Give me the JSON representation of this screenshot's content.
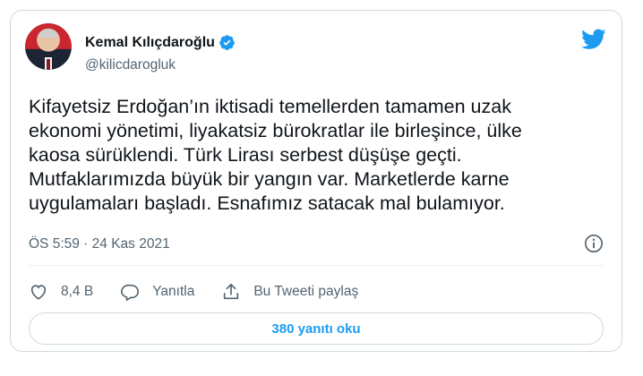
{
  "author": {
    "name": "Kemal Kılıçdaroğlu",
    "handle": "@kilicdarogluk"
  },
  "tweet": {
    "text": "Kifayetsiz Erdoğan’ın iktisadi temellerden tamamen uzak\nekonomi yönetimi, liyakatsiz bürokratlar ile birleşince, ülke\nkaosa sürüklendi. Türk Lirası serbest düşüşe geçti.\nMutfaklarımızda büyük bir yangın var. Marketlerde karne\nuygulamaları başladı. Esnafımız satacak mal bulamıyor.",
    "timestamp": "ÖS 5:59 · 24 Kas 2021"
  },
  "actions": {
    "like_count": "8,4 B",
    "reply_label": "Yanıtla",
    "share_label": "Bu Tweeti paylaş"
  },
  "replies_button": "380 yanıtı oku",
  "colors": {
    "accent": "#1d9bf0",
    "text": "#0f1419",
    "muted": "#536471",
    "border": "#cfd9de"
  },
  "icons": [
    "verified-badge-icon",
    "twitter-bird-icon",
    "info-icon",
    "heart-icon",
    "reply-icon",
    "share-icon"
  ]
}
